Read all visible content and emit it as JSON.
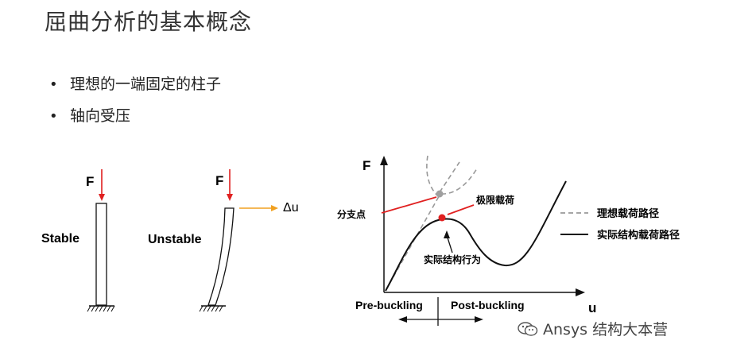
{
  "page": {
    "title": "屈曲分析的基本概念",
    "bullets": [
      "理想的一端固定的柱子",
      "轴向受压"
    ]
  },
  "columns": {
    "stable": {
      "label": "Stable",
      "force": "F"
    },
    "unstable": {
      "label": "Unstable",
      "force": "F",
      "displacement": "Δu"
    }
  },
  "graph": {
    "y_axis_label": "F",
    "x_axis_label": "u",
    "bifurcation_label": "分支点",
    "limit_load_label": "极限载荷",
    "actual_behavior_label": "实际结构行为",
    "pre_buckling_label": "Pre-buckling",
    "post_buckling_label": "Post-buckling",
    "legend": {
      "ideal": "理想载荷路径",
      "actual": "实际结构载荷路径"
    }
  },
  "colors": {
    "force_arrow": "#e02020",
    "displacement_arrow": "#f0a020",
    "ideal_path": "#999999",
    "actual_path": "#111111",
    "limit_point": "#e02020",
    "bifurcation_point": "#a0a0a0"
  },
  "watermark": {
    "text": "Ansys 结构大本营",
    "icon": "wechat-icon"
  }
}
